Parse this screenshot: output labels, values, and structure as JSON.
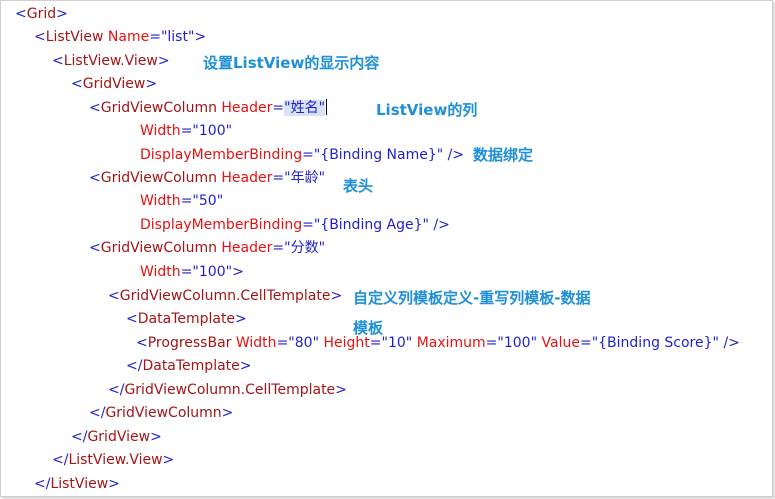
{
  "code": {
    "grid_open": {
      "tag": "Grid"
    },
    "listview_open": {
      "tag": "ListView",
      "attr": "Name",
      "value": "list"
    },
    "listview_view_open": {
      "tag": "ListView.View"
    },
    "gridview_open": {
      "tag": "GridView"
    },
    "col1": {
      "tag": "GridViewColumn",
      "attr": "Header",
      "value": "姓名",
      "width_attr": "Width",
      "width_value": "100",
      "binding_attr": "DisplayMemberBinding",
      "binding_value": "{Binding Name}"
    },
    "col2": {
      "tag": "GridViewColumn",
      "attr": "Header",
      "value": "年龄",
      "width_attr": "Width",
      "width_value": "50",
      "binding_attr": "DisplayMemberBinding",
      "binding_value": "{Binding Age}"
    },
    "col3": {
      "tag": "GridViewColumn",
      "attr": "Header",
      "value": "分数",
      "width_attr": "Width",
      "width_value": "100"
    },
    "celltemplate_open": {
      "tag": "GridViewColumn.CellTemplate"
    },
    "datatemplate_open": {
      "tag": "DataTemplate"
    },
    "progressbar": {
      "tag": "ProgressBar",
      "width_attr": "Width",
      "width_value": "80",
      "height_attr": "Height",
      "height_value": "10",
      "max_attr": "Maximum",
      "max_value": "100",
      "value_attr": "Value",
      "value_value": "{Binding Score}"
    },
    "datatemplate_close": {
      "tag": "DataTemplate"
    },
    "celltemplate_close": {
      "tag": "GridViewColumn.CellTemplate"
    },
    "gridviewcolumn_close": {
      "tag": "GridViewColumn"
    },
    "gridview_close": {
      "tag": "GridView"
    },
    "listview_view_close": {
      "tag": "ListView.View"
    },
    "listview_close": {
      "tag": "ListView"
    }
  },
  "notes": {
    "listview_view": "设置ListView的显示内容",
    "listview_column": "ListView的列",
    "data_binding": "数据绑定",
    "header": "表头",
    "custom_template_line1": "自定义列模板定义-重写列模板-数据",
    "custom_template_line2": "模板"
  },
  "colors": {
    "tag": "#a31515",
    "attribute": "#e81010",
    "value": "#1f1fd0",
    "annotation": "#1f8fd8"
  }
}
